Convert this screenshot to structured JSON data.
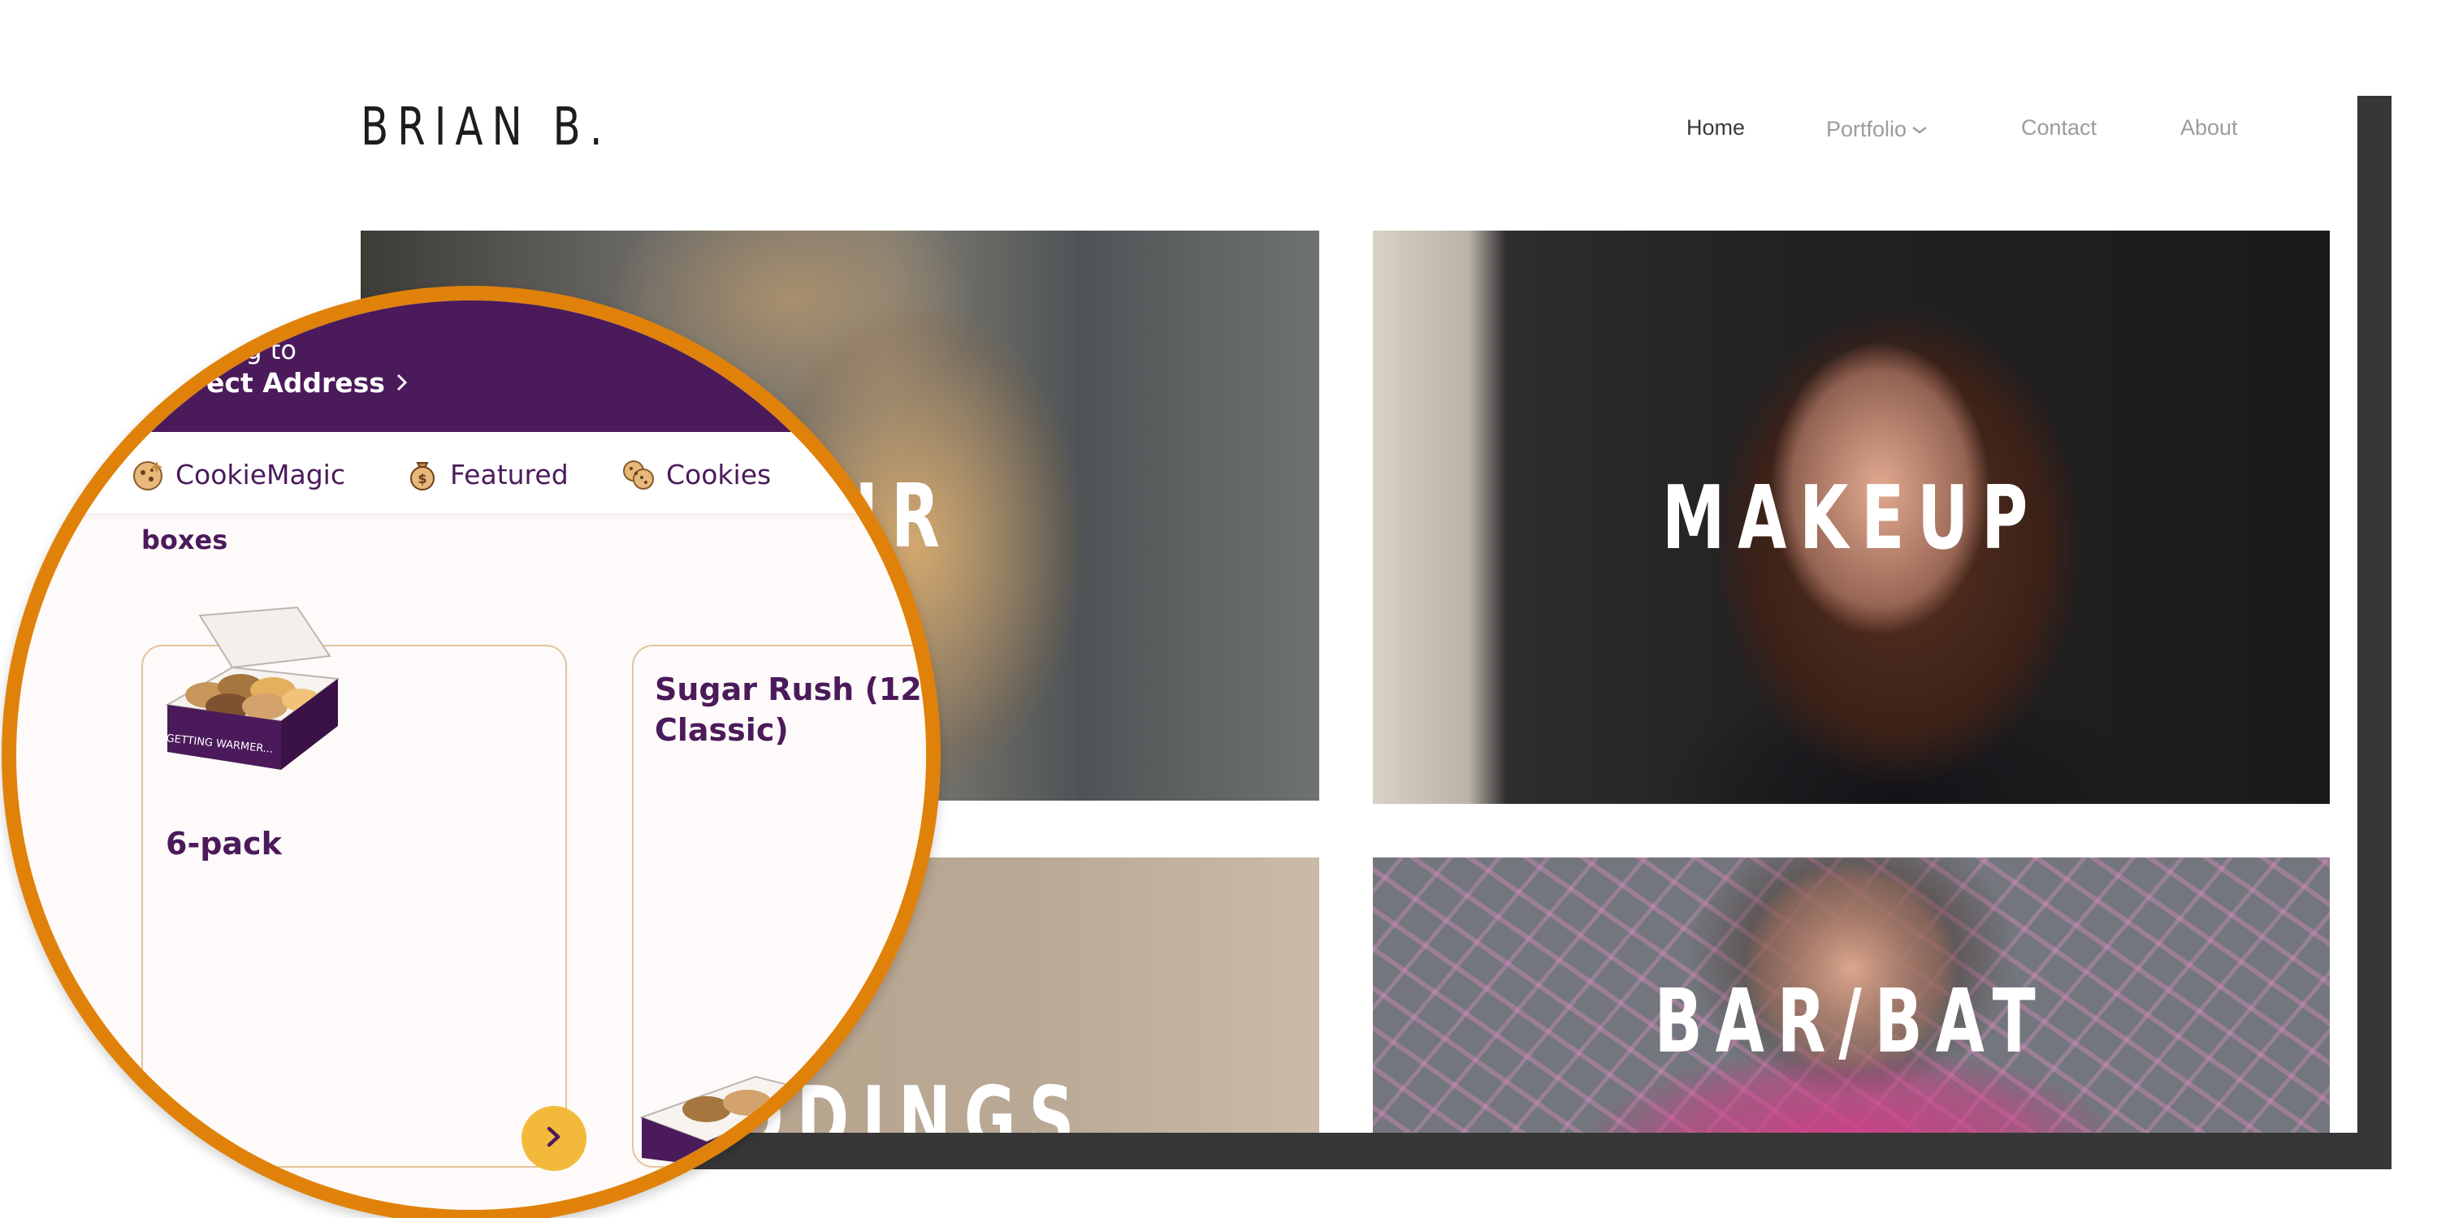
{
  "site": {
    "logo": "BRIAN B.",
    "nav": [
      {
        "label": "Home",
        "active": true
      },
      {
        "label": "Portfolio",
        "has_dropdown": true
      },
      {
        "label": "Contact"
      },
      {
        "label": "About"
      }
    ],
    "tiles": [
      {
        "label": "HAIR"
      },
      {
        "label": "MAKEUP"
      },
      {
        "label": "WEDDINGS"
      },
      {
        "label": "BAR/BAT"
      }
    ]
  },
  "magnifier": {
    "delivery_line1": "ng to",
    "delivery_line2": "ect Address",
    "categories": [
      {
        "label": "CookieMagic",
        "icon": "cookie-icon"
      },
      {
        "label": "Featured",
        "icon": "money-bag-icon"
      },
      {
        "label": "Cookies",
        "icon": "cookies-icon"
      }
    ],
    "section_title": "boxes",
    "cards": [
      {
        "title": "6-pack",
        "box_text": "GETTING WARMER..."
      },
      {
        "title": "Sugar Rush (12 Classic)",
        "title_line1": "Sugar Rush (12",
        "title_line2": "Classic)"
      }
    ],
    "next_button_icon": "chevron-right-icon"
  },
  "colors": {
    "brand_purple": "#4b1a5b",
    "magnifier_ring": "#e0820a",
    "accent_yellow": "#f3b93a",
    "card_border": "#e3c49a",
    "page_shadow": "#373737"
  }
}
